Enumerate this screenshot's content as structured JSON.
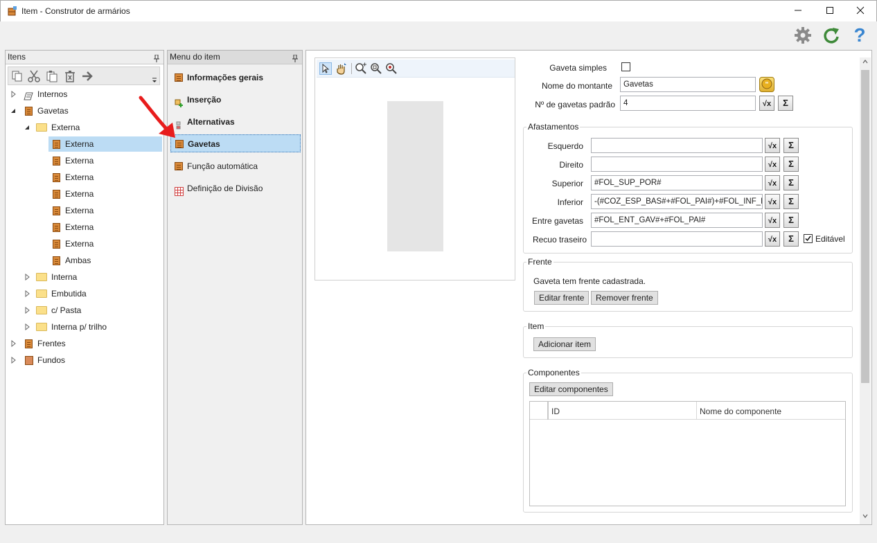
{
  "window": {
    "title": "Item - Construtor de armários",
    "minimize": "—",
    "maximize": "☐",
    "close": "✕"
  },
  "toolbar": {
    "icons": [
      "gear-icon",
      "refresh-icon",
      "help-icon"
    ],
    "help_glyph": "?"
  },
  "items_panel": {
    "header": "Itens",
    "tools": [
      "copy-icon",
      "cut-icon",
      "paste-icon",
      "delete-icon",
      "arrow-right-icon"
    ],
    "tree": [
      {
        "label": "Internos",
        "level": 0,
        "expanded": false
      },
      {
        "label": "Gavetas",
        "level": 0,
        "expanded": true
      },
      {
        "label": "Externa",
        "level": 1,
        "expanded": true
      },
      {
        "label": "Externa",
        "level": 2,
        "selected": true
      },
      {
        "label": "Externa",
        "level": 2
      },
      {
        "label": "Externa",
        "level": 2
      },
      {
        "label": "Externa",
        "level": 2
      },
      {
        "label": "Externa",
        "level": 2
      },
      {
        "label": "Externa",
        "level": 2
      },
      {
        "label": "Externa",
        "level": 2
      },
      {
        "label": "Ambas",
        "level": 2
      },
      {
        "label": "Interna",
        "level": 1,
        "expanded": false
      },
      {
        "label": "Embutida",
        "level": 1,
        "expanded": false
      },
      {
        "label": "c/ Pasta",
        "level": 1,
        "expanded": false
      },
      {
        "label": "Interna p/ trilho",
        "level": 1,
        "expanded": false
      },
      {
        "label": "Frentes",
        "level": 0,
        "expanded": false
      },
      {
        "label": "Fundos",
        "level": 0,
        "expanded": false
      }
    ]
  },
  "menu_panel": {
    "header": "Menu do item",
    "items": [
      {
        "label": "Informações gerais",
        "bold": true
      },
      {
        "label": "Inserção",
        "bold": true
      },
      {
        "label": "Alternativas",
        "bold": true
      },
      {
        "label": "Gavetas",
        "bold": true,
        "selected": true
      },
      {
        "label": "Função automática",
        "bold": false
      },
      {
        "label": "Definição de Divisão",
        "bold": false
      }
    ]
  },
  "form": {
    "gaveta_simples_label": "Gaveta simples",
    "gaveta_simples_checked": false,
    "nome_montante_label": "Nome do montante",
    "nome_montante_value": "Gavetas",
    "n_gavetas_label": "Nº de gavetas padrão",
    "n_gavetas_value": "4",
    "afastamentos": {
      "title": "Afastamentos",
      "esquerdo_label": "Esquerdo",
      "esquerdo_value": "",
      "direito_label": "Direito",
      "direito_value": "",
      "superior_label": "Superior",
      "superior_value": "#FOL_SUP_POR#",
      "inferior_label": "Inferior",
      "inferior_value": "-(#COZ_ESP_BAS#+#FOL_PAI#)+#FOL_INF_F",
      "entre_label": "Entre gavetas",
      "entre_value": "#FOL_ENT_GAV#+#FOL_PAI#",
      "recuo_label": "Recuo traseiro",
      "recuo_value": "",
      "editavel_label": "Editável",
      "editavel_checked": true,
      "sqrt_glyph": "√x",
      "sigma_glyph": "Σ"
    },
    "frente": {
      "title": "Frente",
      "status": "Gaveta tem frente cadastrada.",
      "edit_btn": "Editar frente",
      "remove_btn": "Remover frente"
    },
    "item": {
      "title": "Item",
      "add_btn": "Adicionar item"
    },
    "componentes": {
      "title": "Componentes",
      "edit_btn": "Editar componentes",
      "columns": [
        "ID",
        "Nome do componente"
      ]
    }
  },
  "colors": {
    "selection": "#bcdcf4",
    "cabinet": "#d98a3a",
    "folder": "#fbe08a",
    "annotation_arrow": "#e81c1c"
  }
}
